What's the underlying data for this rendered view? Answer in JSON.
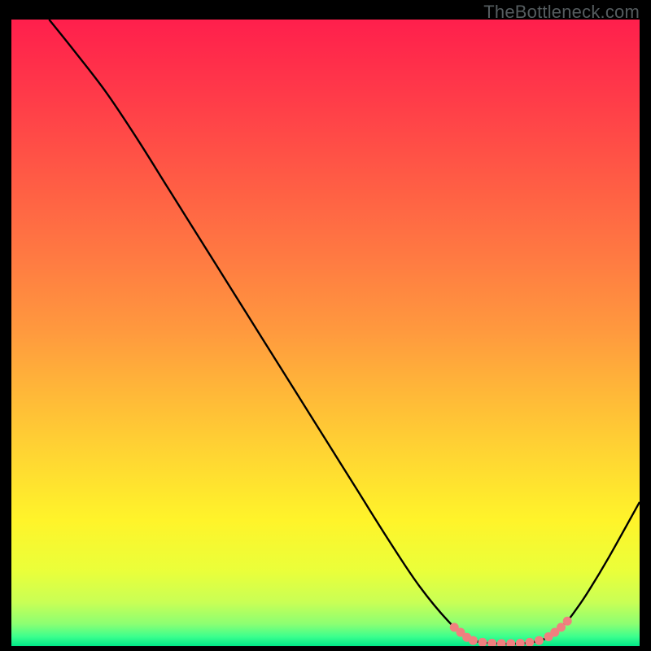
{
  "watermark": "TheBottleneck.com",
  "chart_data": {
    "type": "line",
    "title": "",
    "xlabel": "",
    "ylabel": "",
    "xlim": [
      0,
      100
    ],
    "ylim": [
      0,
      100
    ],
    "grid": false,
    "series": [
      {
        "name": "curve",
        "stroke": "#000000",
        "x": [
          6,
          10,
          15,
          20,
          25,
          30,
          35,
          40,
          45,
          50,
          55,
          60,
          65,
          70,
          73,
          75,
          78,
          80,
          82,
          85,
          88,
          90,
          92,
          95,
          100
        ],
        "y": [
          100,
          95,
          88.5,
          81,
          73,
          65,
          57,
          49,
          41,
          33,
          25,
          17,
          9.5,
          3.5,
          1.2,
          0.6,
          0.4,
          0.4,
          0.5,
          1.2,
          3.5,
          6,
          9,
          14,
          23
        ]
      }
    ],
    "markers": {
      "name": "highlight-dots",
      "color": "#f07f7f",
      "points": [
        {
          "x": 70.5,
          "y": 3.0
        },
        {
          "x": 71.5,
          "y": 2.2
        },
        {
          "x": 72.5,
          "y": 1.4
        },
        {
          "x": 73.5,
          "y": 0.9
        },
        {
          "x": 75.0,
          "y": 0.6
        },
        {
          "x": 76.5,
          "y": 0.45
        },
        {
          "x": 78.0,
          "y": 0.4
        },
        {
          "x": 79.5,
          "y": 0.4
        },
        {
          "x": 81.0,
          "y": 0.45
        },
        {
          "x": 82.5,
          "y": 0.6
        },
        {
          "x": 84.0,
          "y": 0.9
        },
        {
          "x": 85.5,
          "y": 1.5
        },
        {
          "x": 86.5,
          "y": 2.2
        },
        {
          "x": 87.5,
          "y": 3.0
        },
        {
          "x": 88.5,
          "y": 4.0
        }
      ]
    },
    "gradient_stops": [
      {
        "offset": 0.0,
        "color": "#ff1f4c"
      },
      {
        "offset": 0.12,
        "color": "#ff3a49"
      },
      {
        "offset": 0.25,
        "color": "#ff5a45"
      },
      {
        "offset": 0.38,
        "color": "#ff7a42"
      },
      {
        "offset": 0.5,
        "color": "#ff9a3e"
      },
      {
        "offset": 0.6,
        "color": "#ffb938"
      },
      {
        "offset": 0.7,
        "color": "#ffd732"
      },
      {
        "offset": 0.8,
        "color": "#fff42a"
      },
      {
        "offset": 0.88,
        "color": "#eaff3a"
      },
      {
        "offset": 0.93,
        "color": "#c9ff55"
      },
      {
        "offset": 0.965,
        "color": "#8bff73"
      },
      {
        "offset": 0.985,
        "color": "#3bff8e"
      },
      {
        "offset": 1.0,
        "color": "#00e887"
      }
    ]
  }
}
